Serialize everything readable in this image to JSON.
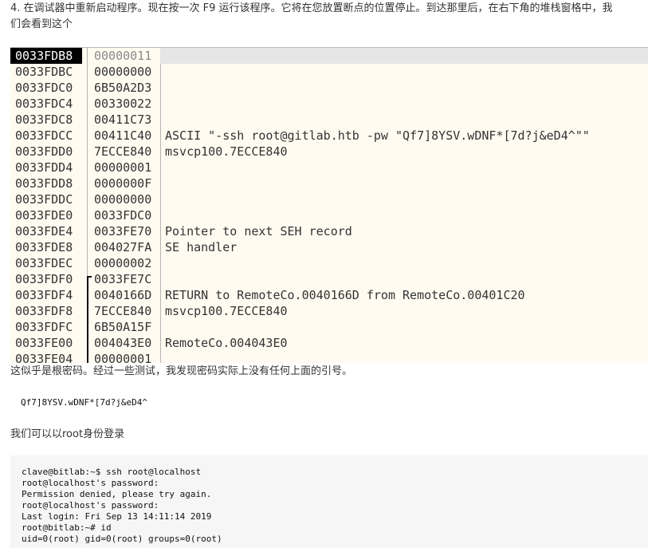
{
  "intro": {
    "line1": "4. 在调试器中重新启动程序。现在按一次 F9 运行该程序。它将在您放置断点的位置停止。到达那里后，在右下角的堆栈窗格中，我",
    "line2": "们会看到这个"
  },
  "stack_pane": {
    "rows": [
      {
        "addr": "0033FDB8",
        "value": "00000011",
        "comment": ""
      },
      {
        "addr": "0033FDBC",
        "value": "00000000",
        "comment": ""
      },
      {
        "addr": "0033FDC0",
        "value": "6B50A2D3",
        "comment": ""
      },
      {
        "addr": "0033FDC4",
        "value": "00330022",
        "comment": ""
      },
      {
        "addr": "0033FDC8",
        "value": "00411C73",
        "comment": ""
      },
      {
        "addr": "0033FDCC",
        "value": "00411C40",
        "comment": "ASCII \"-ssh root@gitlab.htb -pw \"Qf7]8YSV.wDNF*[7d?j&eD4^\"\""
      },
      {
        "addr": "0033FDD0",
        "value": "7ECCE840",
        "comment": "msvcp100.7ECCE840"
      },
      {
        "addr": "0033FDD4",
        "value": "00000001",
        "comment": ""
      },
      {
        "addr": "0033FDD8",
        "value": "0000000F",
        "comment": ""
      },
      {
        "addr": "0033FDDC",
        "value": "00000000",
        "comment": ""
      },
      {
        "addr": "0033FDE0",
        "value": "0033FDC0",
        "comment": ""
      },
      {
        "addr": "0033FDE4",
        "value": "0033FE70",
        "comment": "Pointer to next SEH record"
      },
      {
        "addr": "0033FDE8",
        "value": "004027FA",
        "comment": "SE handler"
      },
      {
        "addr": "0033FDEC",
        "value": "00000002",
        "comment": ""
      },
      {
        "addr": "0033FDF0",
        "value": "0033FE7C",
        "comment": ""
      },
      {
        "addr": "0033FDF4",
        "value": "0040166D",
        "comment": "RETURN to RemoteCo.0040166D from RemoteCo.00401C20"
      },
      {
        "addr": "0033FDF8",
        "value": "7ECCE840",
        "comment": "msvcp100.7ECCE840"
      },
      {
        "addr": "0033FDFC",
        "value": "6B50A15F",
        "comment": ""
      },
      {
        "addr": "0033FE00",
        "value": "004043E0",
        "comment": "RemoteCo.004043E0"
      },
      {
        "addr": "0033FE04",
        "value": "00000001",
        "comment": ""
      }
    ]
  },
  "note": "这似乎是根密码。经过一些测试，我发现密码实际上没有任何上面的引号。",
  "password_code": "Qf7]8YSV.wDNF*[7d?j&eD4^",
  "login_text": "我们可以以root身份登录",
  "terminal": {
    "lines": [
      "clave@bitlab:~$ ssh root@localhost",
      "root@localhost's password:",
      "Permission denied, please try again.",
      "root@localhost's password:",
      "Last login: Fri Sep 13 14:11:14 2019",
      "root@bitlab:~# id",
      "uid=0(root) gid=0(root) groups=0(root)"
    ]
  }
}
